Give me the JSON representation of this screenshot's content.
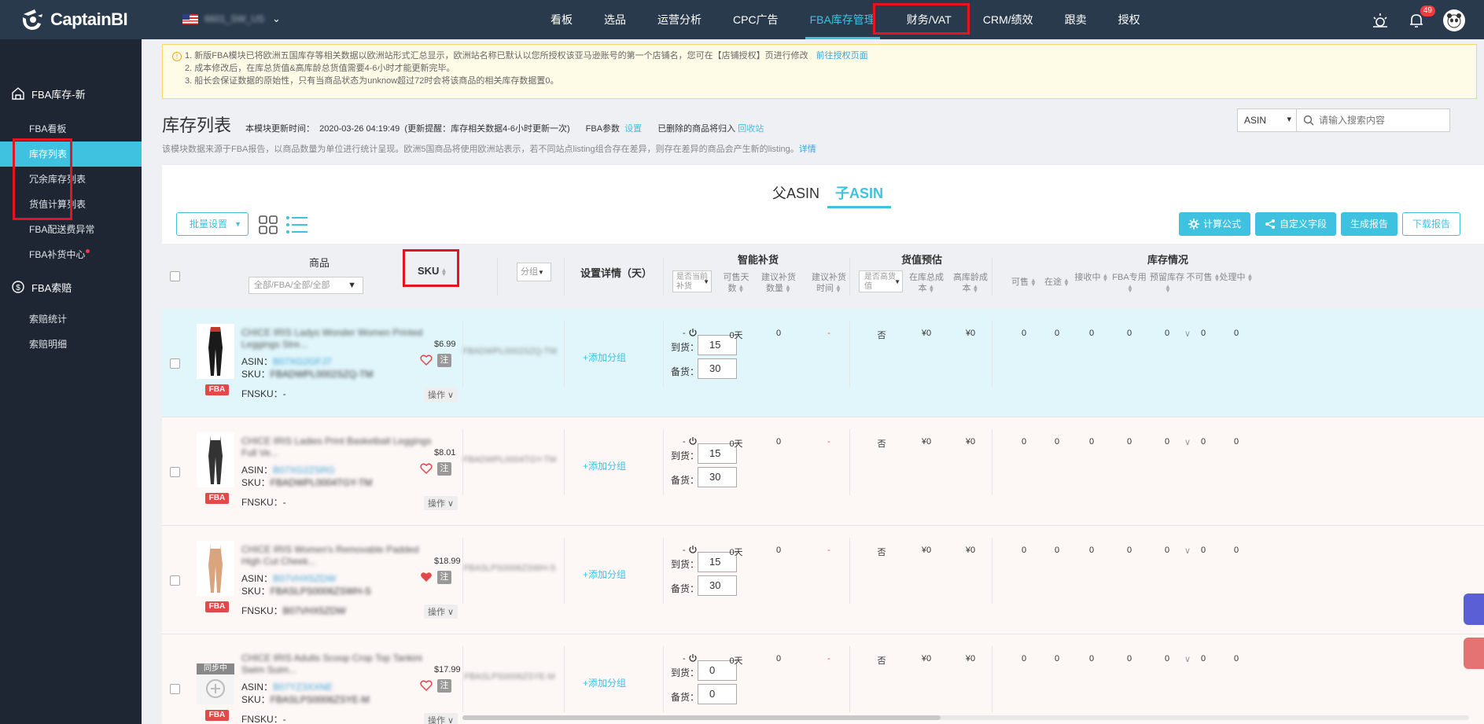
{
  "app": {
    "logo_text": "CaptainBI",
    "store_account": "6601_SW_US"
  },
  "nav": [
    {
      "label": "看板",
      "active": false
    },
    {
      "label": "选品",
      "active": false
    },
    {
      "label": "运营分析",
      "active": false
    },
    {
      "label": "CPC广告",
      "active": false
    },
    {
      "label": "FBA库存管理",
      "active": true
    },
    {
      "label": "财务/VAT",
      "active": false
    },
    {
      "label": "CRM/绩效",
      "active": false
    },
    {
      "label": "跟卖",
      "active": false
    },
    {
      "label": "授权",
      "active": false
    }
  ],
  "notification_count": "49",
  "sidebar": {
    "section1": "FBA库存-新",
    "items1": [
      {
        "label": "FBA看板",
        "active": false,
        "dot": false
      },
      {
        "label": "库存列表",
        "active": true,
        "dot": false
      },
      {
        "label": "冗余库存列表",
        "active": false,
        "dot": false
      },
      {
        "label": "货值计算列表",
        "active": false,
        "dot": false
      },
      {
        "label": "FBA配送费异常",
        "active": false,
        "dot": false
      },
      {
        "label": "FBA补货中心",
        "active": false,
        "dot": true
      }
    ],
    "section2": "FBA索赔",
    "items2": [
      {
        "label": "索赔统计"
      },
      {
        "label": "索赔明细"
      }
    ]
  },
  "notice": {
    "line1": "1. 新版FBA模块已将欧洲五国库存等相关数据以欧洲站形式汇总显示，欧洲站名称已默认以您所授权该亚马逊账号的第一个店铺名，您可在【店铺授权】页进行修改",
    "line1_link": "前往授权页面",
    "line2": "2. 成本修改后，在库总货值&高库龄总货值需要4-6小时才能更新完毕。",
    "line3": "3. 船长会保证数据的原始性，只有当商品状态为unknow超过72时会将该商品的相关库存数据置0。"
  },
  "page": {
    "title": "库存列表",
    "update_label": "本模块更新时间：",
    "update_time": "2020-03-26 04:19:49",
    "update_hint": "(更新提醒：库存相关数据4-6小时更新一次)",
    "fba_param_label": "FBA参数",
    "fba_param_link": "设置",
    "deleted_label": "已删除的商品将归入",
    "deleted_link": "回收站",
    "desc": "该模块数据来源于FBA报告，以商品数量为单位进行统计呈现。欧洲5国商品将使用欧洲站表示，若不同站点listing组合存在差异，则存在差异的商品会产生新的listing。",
    "desc_link": "详情"
  },
  "search": {
    "type": "ASIN",
    "placeholder": "请输入搜索内容"
  },
  "tabs": [
    {
      "label": "父ASIN",
      "active": false
    },
    {
      "label": "子ASIN",
      "active": true
    }
  ],
  "toolbar": {
    "bulk_label": "批量设置",
    "calc_label": "计算公式",
    "custom_label": "自定义字段",
    "report_label": "生成报告",
    "download_label": "下载报告"
  },
  "table_head": {
    "product": "商品",
    "product_filter": "全部/FBA/全部/全部",
    "sku": "SKU",
    "group": "分组",
    "settings": "设置详情（天）",
    "smart": "智能补货",
    "smart_sub": [
      "是否当前补货",
      "可售天数",
      "建议补货数量",
      "建议补货时间"
    ],
    "value": "货值预估",
    "value_sub": [
      "是否高货值",
      "在库总成本",
      "高库龄成本"
    ],
    "stock": "库存情况",
    "stock_sub": [
      "可售",
      "在途",
      "接收中",
      "FBA专用",
      "预留库存",
      "不可售",
      "处理中"
    ]
  },
  "rows": [
    {
      "name": "CHICE IRIS Ladys Wonder Women Printed Leggings Stre...",
      "price": "$6.99",
      "asin": "B07XG2GFJ7",
      "sku": "FBADWPL0002SZQ-TM",
      "fnsku": "-",
      "sku_col": "FBADWPL0002SZQ-TM",
      "arrive": "15",
      "stock": "30",
      "liked": false,
      "sync": false,
      "smart": [
        "0天",
        "0",
        "-"
      ],
      "value": [
        "否",
        "¥0",
        "¥0"
      ],
      "inv": [
        "0",
        "0",
        "0",
        "0",
        "0",
        "0",
        "0"
      ]
    },
    {
      "name": "CHICE IRIS Ladies Print Basketball Leggings Full Ve...",
      "price": "$8.01",
      "asin": "B07XG2ZSRG",
      "sku": "FBADWPL0004TGY-TM",
      "fnsku": "-",
      "sku_col": "FBADWPL0004TGY-TM",
      "arrive": "15",
      "stock": "30",
      "liked": false,
      "sync": false,
      "smart": [
        "0天",
        "0",
        "-"
      ],
      "value": [
        "否",
        "¥0",
        "¥0"
      ],
      "inv": [
        "0",
        "0",
        "0",
        "0",
        "0",
        "0",
        "0"
      ]
    },
    {
      "name": "CHICE IRIS Women's Removable Padded High Cut Cheek...",
      "price": "$18.99",
      "asin": "B07VHX5ZDW",
      "sku": "FBASLPS0006ZSWH-S",
      "fnsku": "B07VHX5ZDW",
      "sku_col": "FBASLPS0006ZSWH-S",
      "arrive": "15",
      "stock": "30",
      "liked": true,
      "sync": false,
      "smart": [
        "0天",
        "0",
        "-"
      ],
      "value": [
        "否",
        "¥0",
        "¥0"
      ],
      "inv": [
        "0",
        "0",
        "0",
        "0",
        "0",
        "0",
        "0"
      ]
    },
    {
      "name": "CHICE IRIS Adults Scoop Crop Top Tankini Swim Suim...",
      "price": "$17.99",
      "asin": "B07YZ3XXNE",
      "sku": "FBASLPS0006ZSYE-M",
      "fnsku": "-",
      "sku_col": "FBASLPS0006ZSYE-M",
      "arrive": "0",
      "stock": "0",
      "liked": false,
      "sync": true,
      "sync_label": "同步中",
      "smart": [
        "0天",
        "0",
        "-"
      ],
      "value": [
        "否",
        "¥0",
        "¥0"
      ],
      "inv": [
        "0",
        "0",
        "0",
        "0",
        "0",
        "0",
        "0"
      ]
    }
  ],
  "labels": {
    "asin": "ASIN：",
    "sku": "SKU：",
    "fnsku": "FNSKU：",
    "arrive": "到货：",
    "stock": "备货：",
    "add_group": "+添加分组",
    "op": "操作",
    "note": "注",
    "fba": "FBA",
    "smart_dash": "-"
  }
}
